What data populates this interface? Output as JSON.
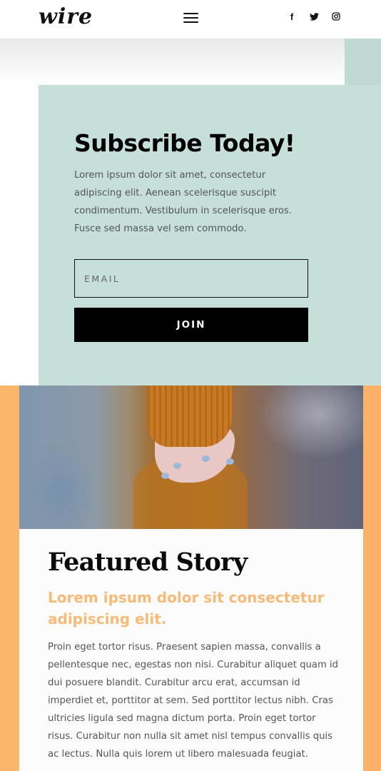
{
  "header": {
    "logo_text": "wire",
    "menu_icon": "hamburger-menu-icon",
    "social": [
      {
        "name": "facebook-icon",
        "glyph": "f"
      },
      {
        "name": "twitter-icon"
      },
      {
        "name": "instagram-icon"
      }
    ]
  },
  "subscribe": {
    "title": "Subscribe Today!",
    "text": "Lorem ipsum dolor sit amet, consectetur adipiscing elit. Aenean scelerisque suscipit condimentum. Vestibulum in scelerisque eros. Fusce sed massa vel sem commodo.",
    "email_placeholder": "EMAIL",
    "join_label": "JOIN",
    "background": "#c6dfda"
  },
  "featured": {
    "title": "Featured Story",
    "subtitle": "Lorem ipsum dolor sit consectetur adipiscing elit.",
    "body": "Proin eget tortor risus. Praesent sapien massa, convallis a pellentesque nec, egestas non nisi. Curabitur aliquet quam id dui posuere blandit. Curabitur arcu erat, accumsan id imperdiet et, porttitor at sem. Sed porttitor lectus nibh. Cras ultricies ligula sed magna dictum porta. Proin eget tortor risus. Curabitur non nulla sit amet nisl tempus convallis quis ac lectus. Nulla quis lorem ut libero malesuada feugiat.",
    "accent": "#f8ba77",
    "image": "hand-in-sleeve-photo"
  }
}
